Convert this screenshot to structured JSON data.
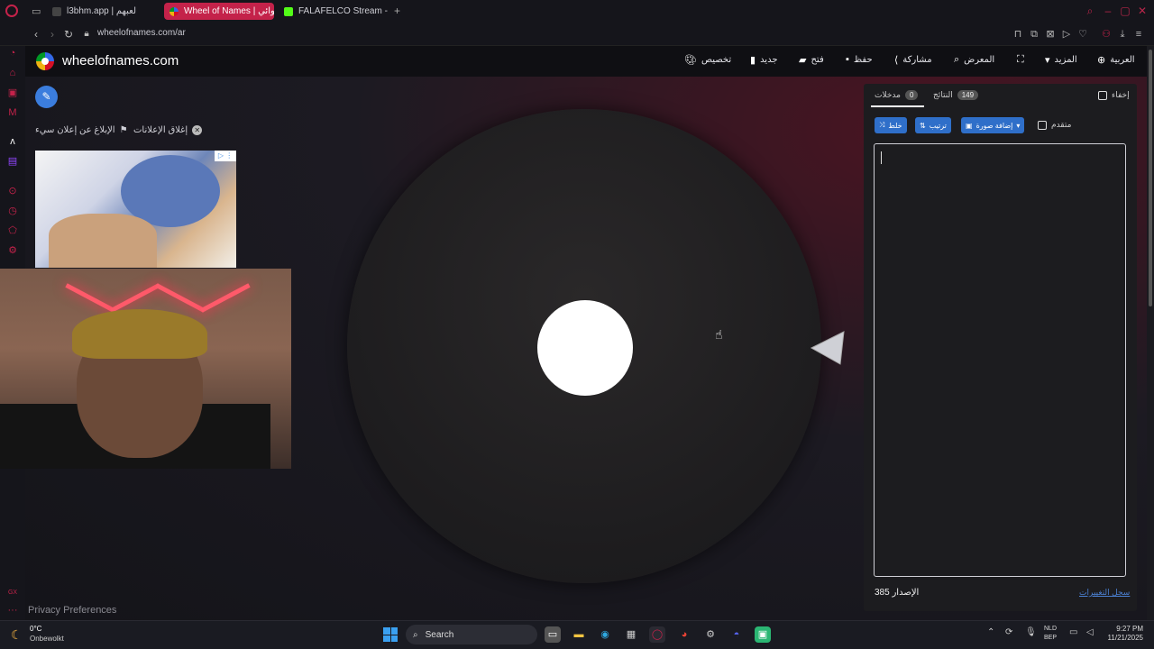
{
  "browser": {
    "tabs": [
      {
        "label": "l3bhm.app | لعبهم",
        "active": false
      },
      {
        "label": "Wheel of Names | عشوائي",
        "active": true
      },
      {
        "label": "FALAFELCO Stream - Wat",
        "active": false
      }
    ],
    "new_tab_icon": "plus-icon",
    "url": "wheelofnames.com/ar"
  },
  "app": {
    "site_name": "wheelofnames.com",
    "nav": {
      "customize": "تخصيص",
      "new": "جديد",
      "open": "فتح",
      "save": "حفظ",
      "share": "مشاركة",
      "gallery": "المعرض",
      "more": "المزيد",
      "language": "العربية"
    },
    "ads": {
      "hide_ads": "إغلاق الإعلانات",
      "report_ad": "الإبلاغ عن إعلان سيء"
    },
    "privacy": "Privacy Preferences"
  },
  "panel": {
    "hide_label": "إخفاء",
    "tabs": [
      {
        "label": "النتائج",
        "count": "149"
      },
      {
        "label": "مدخلات",
        "count": "0"
      }
    ],
    "buttons": {
      "shuffle": "خلط",
      "sort": "ترتيب",
      "add_image": "إضافة صورة",
      "advanced": "متقدم"
    },
    "version_label": "الإصدار 385",
    "changelog": "سجل التغييرات"
  },
  "taskbar": {
    "temperature": "0°C",
    "condition": "Onbewolkt",
    "search_placeholder": "Search",
    "lang_line1": "NLD",
    "lang_line2": "BEP",
    "time": "9:27 PM",
    "date": "11/21/2025"
  },
  "colors": {
    "accent": "#3b7ddd",
    "tab_active": "#c4224a",
    "panel_bg": "#1c1c1f"
  }
}
